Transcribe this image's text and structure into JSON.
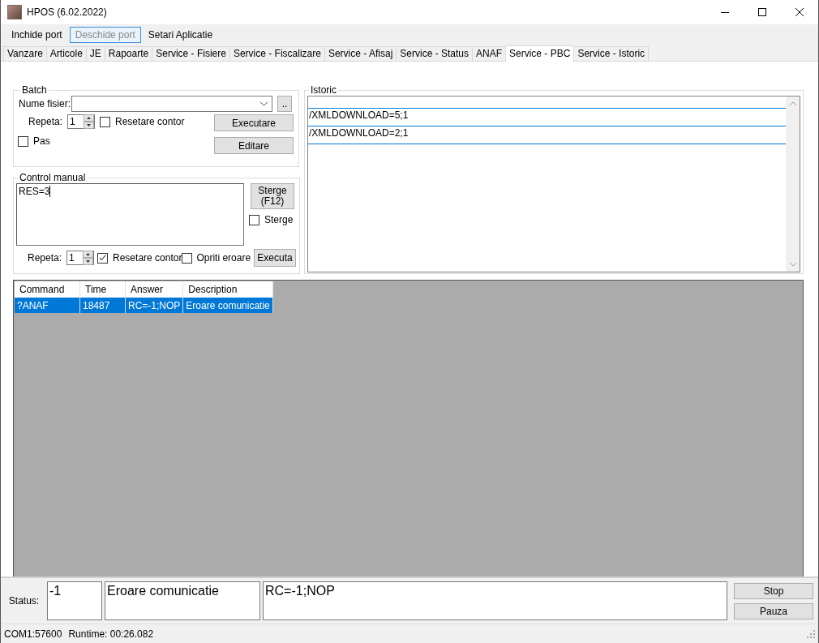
{
  "window": {
    "title": "HPOS (6.02.2022)"
  },
  "menu": [
    {
      "label": "Inchide port",
      "disabled": false
    },
    {
      "label": "Deschide port",
      "disabled": true
    },
    {
      "label": "Setari Aplicatie",
      "disabled": false
    }
  ],
  "tabs": [
    {
      "label": "Vanzare",
      "selected": false
    },
    {
      "label": "Articole",
      "selected": false
    },
    {
      "label": "JE",
      "selected": false
    },
    {
      "label": "Rapoarte",
      "selected": false
    },
    {
      "label": "Service - Fisiere",
      "selected": false
    },
    {
      "label": "Service - Fiscalizare",
      "selected": false
    },
    {
      "label": "Service - Afisaj",
      "selected": false
    },
    {
      "label": "Service - Status",
      "selected": false
    },
    {
      "label": "ANAF",
      "selected": false
    },
    {
      "label": "Service - PBC",
      "selected": true
    },
    {
      "label": "Service - Istoric",
      "selected": false
    }
  ],
  "batch": {
    "title": "Batch",
    "file_label": "Nume fisier:",
    "browse_button": "..",
    "repeat_label": "Repeta:",
    "repeat_value": "1",
    "reset_counter": {
      "label": "Resetare contor",
      "checked": false
    },
    "step": {
      "label": "Pas",
      "checked": false
    },
    "buttons": [
      "Executare",
      "Editare"
    ]
  },
  "manual": {
    "title": "Control manual",
    "command": "RES=3",
    "clear_button": "Sterge (F12)",
    "clear_check": {
      "label": "Sterge",
      "checked": false
    },
    "repeat_label": "Repeta:",
    "repeat_value": "1",
    "reset_counter": {
      "label": "Resetare contor",
      "checked": true
    },
    "stop_on_error": {
      "label": "Opriti eroare",
      "checked": false
    },
    "execute_button": "Executa"
  },
  "history": {
    "title": "Istoric",
    "items": [
      "/XMLDOWNLOAD=5;1",
      "/XMLDOWNLOAD=2;1"
    ]
  },
  "table": {
    "columns": [
      "Command",
      "Time",
      "Answer",
      "Description"
    ],
    "rows": [
      {
        "cells": [
          "?ANAF",
          "18487",
          "RC=-1;NOP",
          "Eroare comunicatie"
        ],
        "selected": true
      }
    ]
  },
  "status": {
    "label": "Status:",
    "code": "-1",
    "message": "Eroare comunicatie",
    "answer": "RC=-1;NOP",
    "buttons": [
      "Stop",
      "Pauza"
    ]
  },
  "status_bar": {
    "port": "COM1:57600",
    "runtime": "Runtime: 00:26.082"
  }
}
